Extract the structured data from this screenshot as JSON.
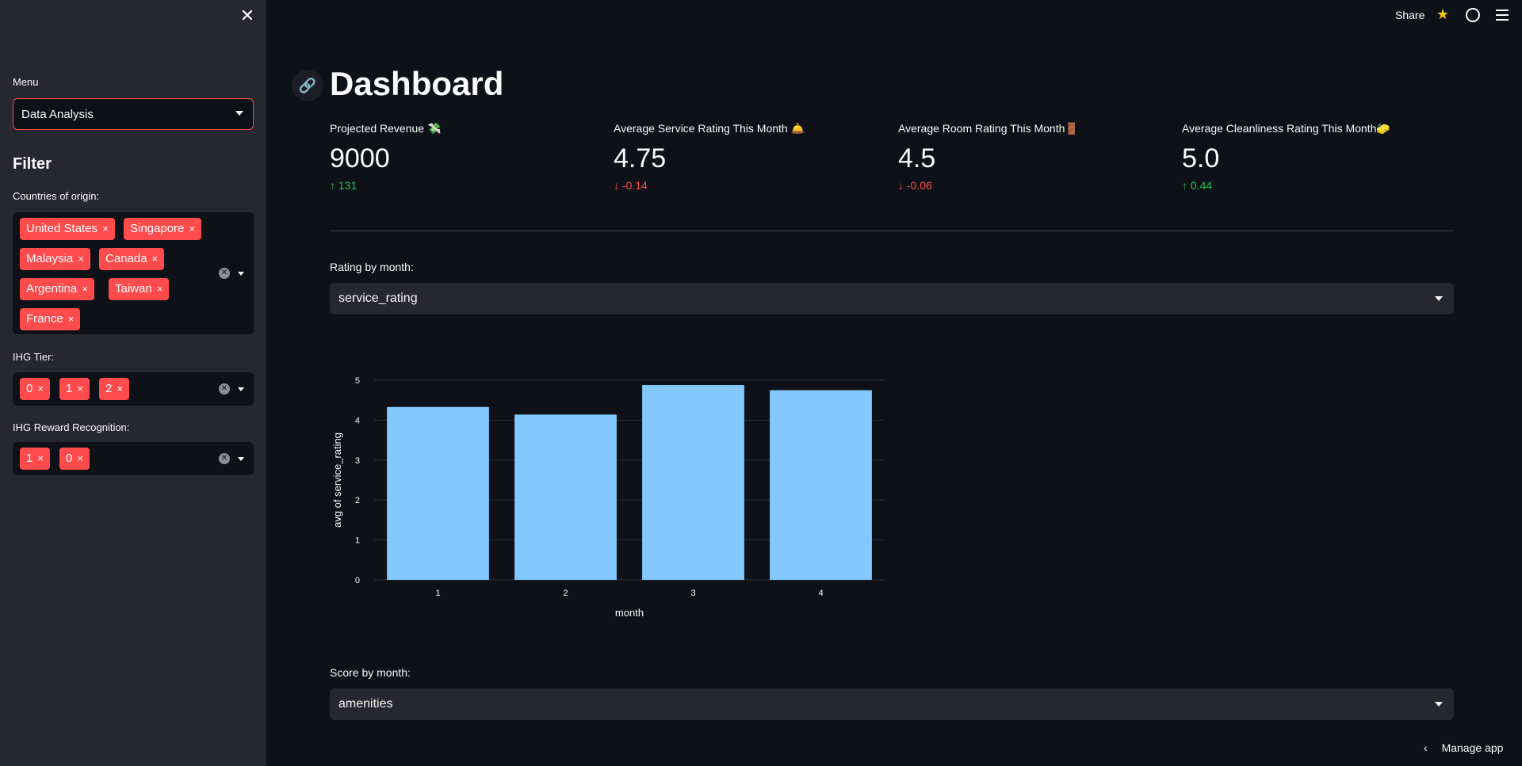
{
  "sidebar": {
    "close_icon": "close-icon",
    "menu_label": "Menu",
    "menu_value": "Data Analysis",
    "filter_heading": "Filter",
    "countries_label": "Countries of origin:",
    "countries": [
      "United States",
      "Singapore",
      "Malaysia",
      "Canada",
      "Argentina",
      "Taiwan",
      "France"
    ],
    "tier_label": "IHG Tier:",
    "tiers": [
      "0",
      "1",
      "2"
    ],
    "reward_label": "IHG Reward Recognition:",
    "rewards": [
      "1",
      "0"
    ],
    "chip_remove": "×"
  },
  "topbar": {
    "share": "Share"
  },
  "main": {
    "title": "Dashboard",
    "metrics": [
      {
        "label": "Projected Revenue 💸",
        "value": "9000",
        "delta": "131",
        "direction": "up"
      },
      {
        "label": "Average Service Rating This Month 🛎️",
        "value": "4.75",
        "delta": "-0.14",
        "direction": "down"
      },
      {
        "label": "Average Room Rating This Month🚪",
        "value": "4.5",
        "delta": "-0.06",
        "direction": "down"
      },
      {
        "label": "Average Cleanliness Rating This Month🧽",
        "value": "5.0",
        "delta": "0.44",
        "direction": "up"
      }
    ],
    "rating_label": "Rating by month:",
    "rating_value": "service_rating",
    "score_label": "Score by month:",
    "score_value": "amenities"
  },
  "chart_data": {
    "type": "bar",
    "categories": [
      "1",
      "2",
      "3",
      "4"
    ],
    "values": [
      4.33,
      4.14,
      4.88,
      4.75
    ],
    "xlabel": "month",
    "ylabel": "avg of service_rating",
    "ylim": [
      0,
      5
    ],
    "yticks": [
      0,
      1,
      2,
      3,
      4,
      5
    ],
    "bar_color": "#83c9ff",
    "grid": true
  },
  "footer": {
    "manage": "Manage app"
  },
  "colors": {
    "accent": "#ff4b4b",
    "up": "#21c354",
    "down": "#ff4b4b"
  }
}
